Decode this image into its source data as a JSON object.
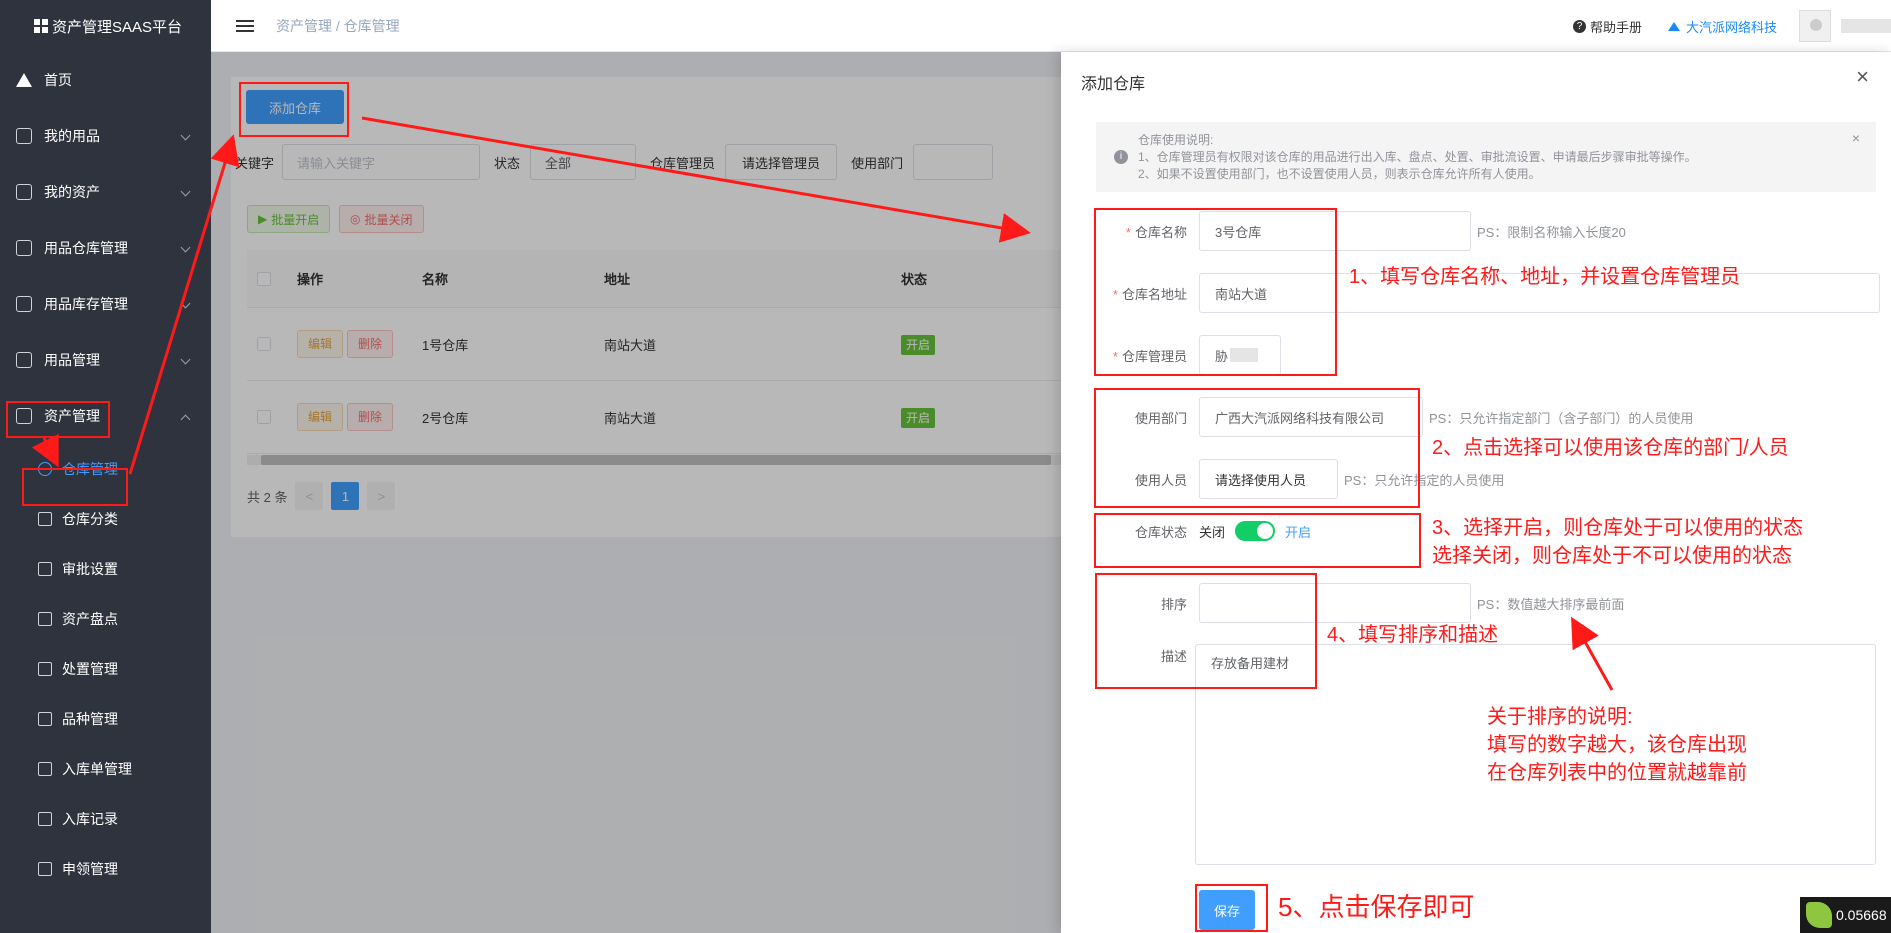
{
  "sidebar": {
    "logo": "资产管理SAAS平台",
    "items": [
      {
        "label": "首页"
      },
      {
        "label": "我的用品"
      },
      {
        "label": "我的资产"
      },
      {
        "label": "用品仓库管理"
      },
      {
        "label": "用品库存管理"
      },
      {
        "label": "用品管理"
      },
      {
        "label": "资产管理"
      }
    ],
    "sub_items": [
      {
        "label": "仓库管理"
      },
      {
        "label": "仓库分类"
      },
      {
        "label": "审批设置"
      },
      {
        "label": "资产盘点"
      },
      {
        "label": "处置管理"
      },
      {
        "label": "品种管理"
      },
      {
        "label": "入库单管理"
      },
      {
        "label": "入库记录"
      },
      {
        "label": "申领管理"
      }
    ]
  },
  "header": {
    "breadcrumb_root": "资产管理",
    "breadcrumb_sep": "/",
    "breadcrumb_current": "仓库管理",
    "help": "帮助手册",
    "org": "大汽派网络科技"
  },
  "list": {
    "add_button": "添加仓库",
    "keyword_label": "关键字",
    "keyword_placeholder": "请输入关键字",
    "status_label": "状态",
    "status_value": "全部",
    "manager_label": "仓库管理员",
    "manager_button": "请选择管理员",
    "dept_label": "使用部门",
    "batch_open": "批量开启",
    "batch_close": "批量关闭",
    "columns": [
      "操作",
      "名称",
      "地址",
      "状态"
    ],
    "rows": [
      {
        "edit": "编辑",
        "delete": "删除",
        "name": "1号仓库",
        "address": "南站大道",
        "status": "开启"
      },
      {
        "edit": "编辑",
        "delete": "删除",
        "name": "2号仓库",
        "address": "南站大道",
        "status": "开启"
      }
    ],
    "total": "共 2 条",
    "page": "1",
    "prev": "<",
    "next": ">"
  },
  "drawer": {
    "title": "添加仓库",
    "close": "×",
    "alert_title": "仓库使用说明:",
    "alert_line1": "1、仓库管理员有权限对该仓库的用品进行出入库、盘点、处置、审批流设置、申请最后步骤审批等操作。",
    "alert_line2": "2、如果不设置使用部门，也不设置使用人员，则表示仓库允许所有人使用。",
    "name_label": "仓库名称",
    "name_value": "3号仓库",
    "name_ps": "PS：限制名称输入长度20",
    "addr_label": "仓库名地址",
    "addr_value": "南站大道",
    "manager_label": "仓库管理员",
    "manager_value": "胁",
    "dept_label": "使用部门",
    "dept_value": "广西大汽派网络科技有限公司",
    "dept_ps": "PS：只允许指定部门（含子部门）的人员使用",
    "user_label": "使用人员",
    "user_button": "请选择使用人员",
    "user_ps": "PS：只允许指定的人员使用",
    "status_label": "仓库状态",
    "status_off": "关闭",
    "status_on": "开启",
    "sort_label": "排序",
    "sort_value": "",
    "sort_ps": "PS：数值越大排序最前面",
    "desc_label": "描述",
    "desc_value": "存放备用建材",
    "save": "保存"
  },
  "annotations": {
    "a1": "1、填写仓库名称、地址，并设置仓库管理员",
    "a2": "2、点击选择可以使用该仓库的部门/人员",
    "a3_1": "3、选择开启，则仓库处于可以使用的状态",
    "a3_2": "选择关闭，则仓库处于不可以使用的状态",
    "a4": "4、填写排序和描述",
    "note_1": "关于排序的说明:",
    "note_2": "填写的数字越大，该仓库出现",
    "note_3": "在仓库列表中的位置就越靠前",
    "a5": "5、点击保存即可"
  },
  "badge": "0.05668",
  "colors": {
    "annotation": "#ff1a1a",
    "primary": "#409eff",
    "sidebar": "#2f333d",
    "switch_on": "#13ce66"
  }
}
